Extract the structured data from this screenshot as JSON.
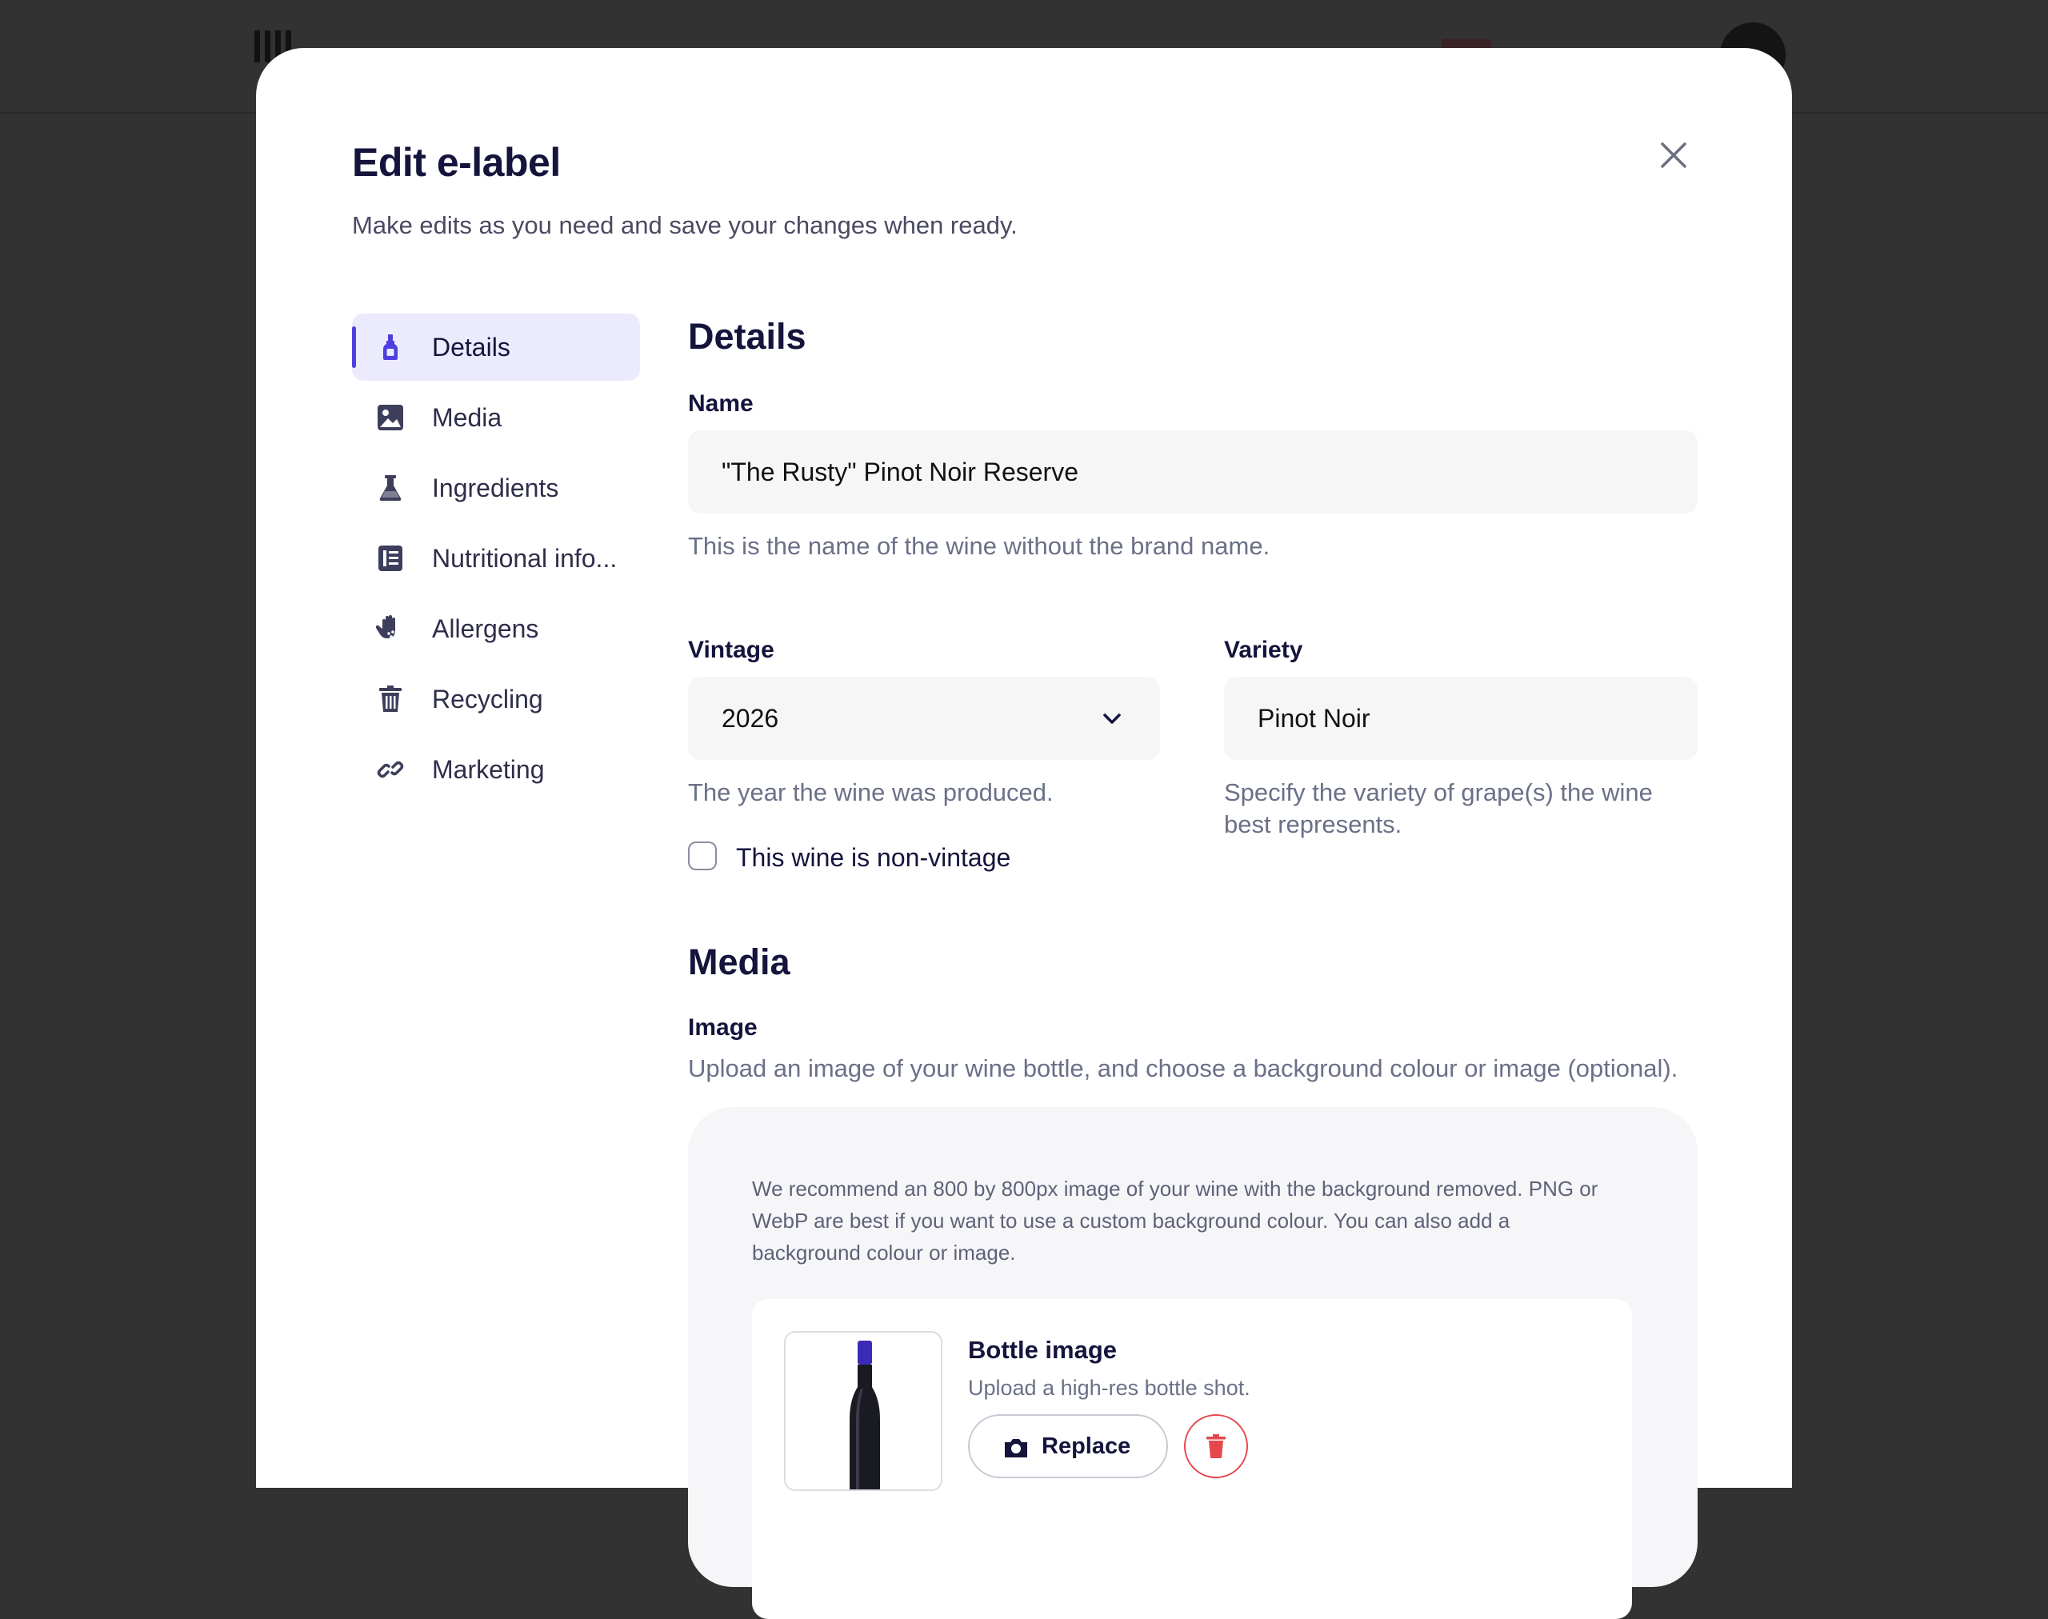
{
  "modal": {
    "title": "Edit e-label",
    "subtitle": "Make edits as you need and save your changes when ready."
  },
  "nav": {
    "items": [
      {
        "label": "Details",
        "icon": "wine-bottle-icon",
        "active": true
      },
      {
        "label": "Media",
        "icon": "image-icon"
      },
      {
        "label": "Ingredients",
        "icon": "flask-icon"
      },
      {
        "label": "Nutritional info...",
        "icon": "nutrition-book-icon"
      },
      {
        "label": "Allergens",
        "icon": "hand-allergen-icon"
      },
      {
        "label": "Recycling",
        "icon": "trash-bin-icon"
      },
      {
        "label": "Marketing",
        "icon": "link-icon"
      }
    ]
  },
  "details": {
    "heading": "Details",
    "name_label": "Name",
    "name_value": "\"The Rusty\" Pinot Noir Reserve",
    "name_help": "This is the name of the wine without the brand name.",
    "vintage_label": "Vintage",
    "vintage_value": "2026",
    "vintage_help": "The year the wine was produced.",
    "non_vintage_label": "This wine is non-vintage",
    "variety_label": "Variety",
    "variety_value": "Pinot Noir",
    "variety_help": "Specify the variety of grape(s) the wine best represents."
  },
  "media": {
    "heading": "Media",
    "image_label": "Image",
    "image_help": "Upload an image of your wine bottle, and choose a background colour or image (optional).",
    "recommendation": "We recommend an 800 by 800px image of your wine with the background removed. PNG or WebP are best if you want to use a custom background colour. You can also add a background colour or image.",
    "bottle_title": "Bottle image",
    "bottle_sub": "Upload a high-res bottle shot.",
    "replace_label": "Replace"
  },
  "colors": {
    "accent": "#4f3fe0",
    "active_nav_bg": "#ecebfd",
    "heading": "#14143c",
    "danger": "#e5484d"
  }
}
